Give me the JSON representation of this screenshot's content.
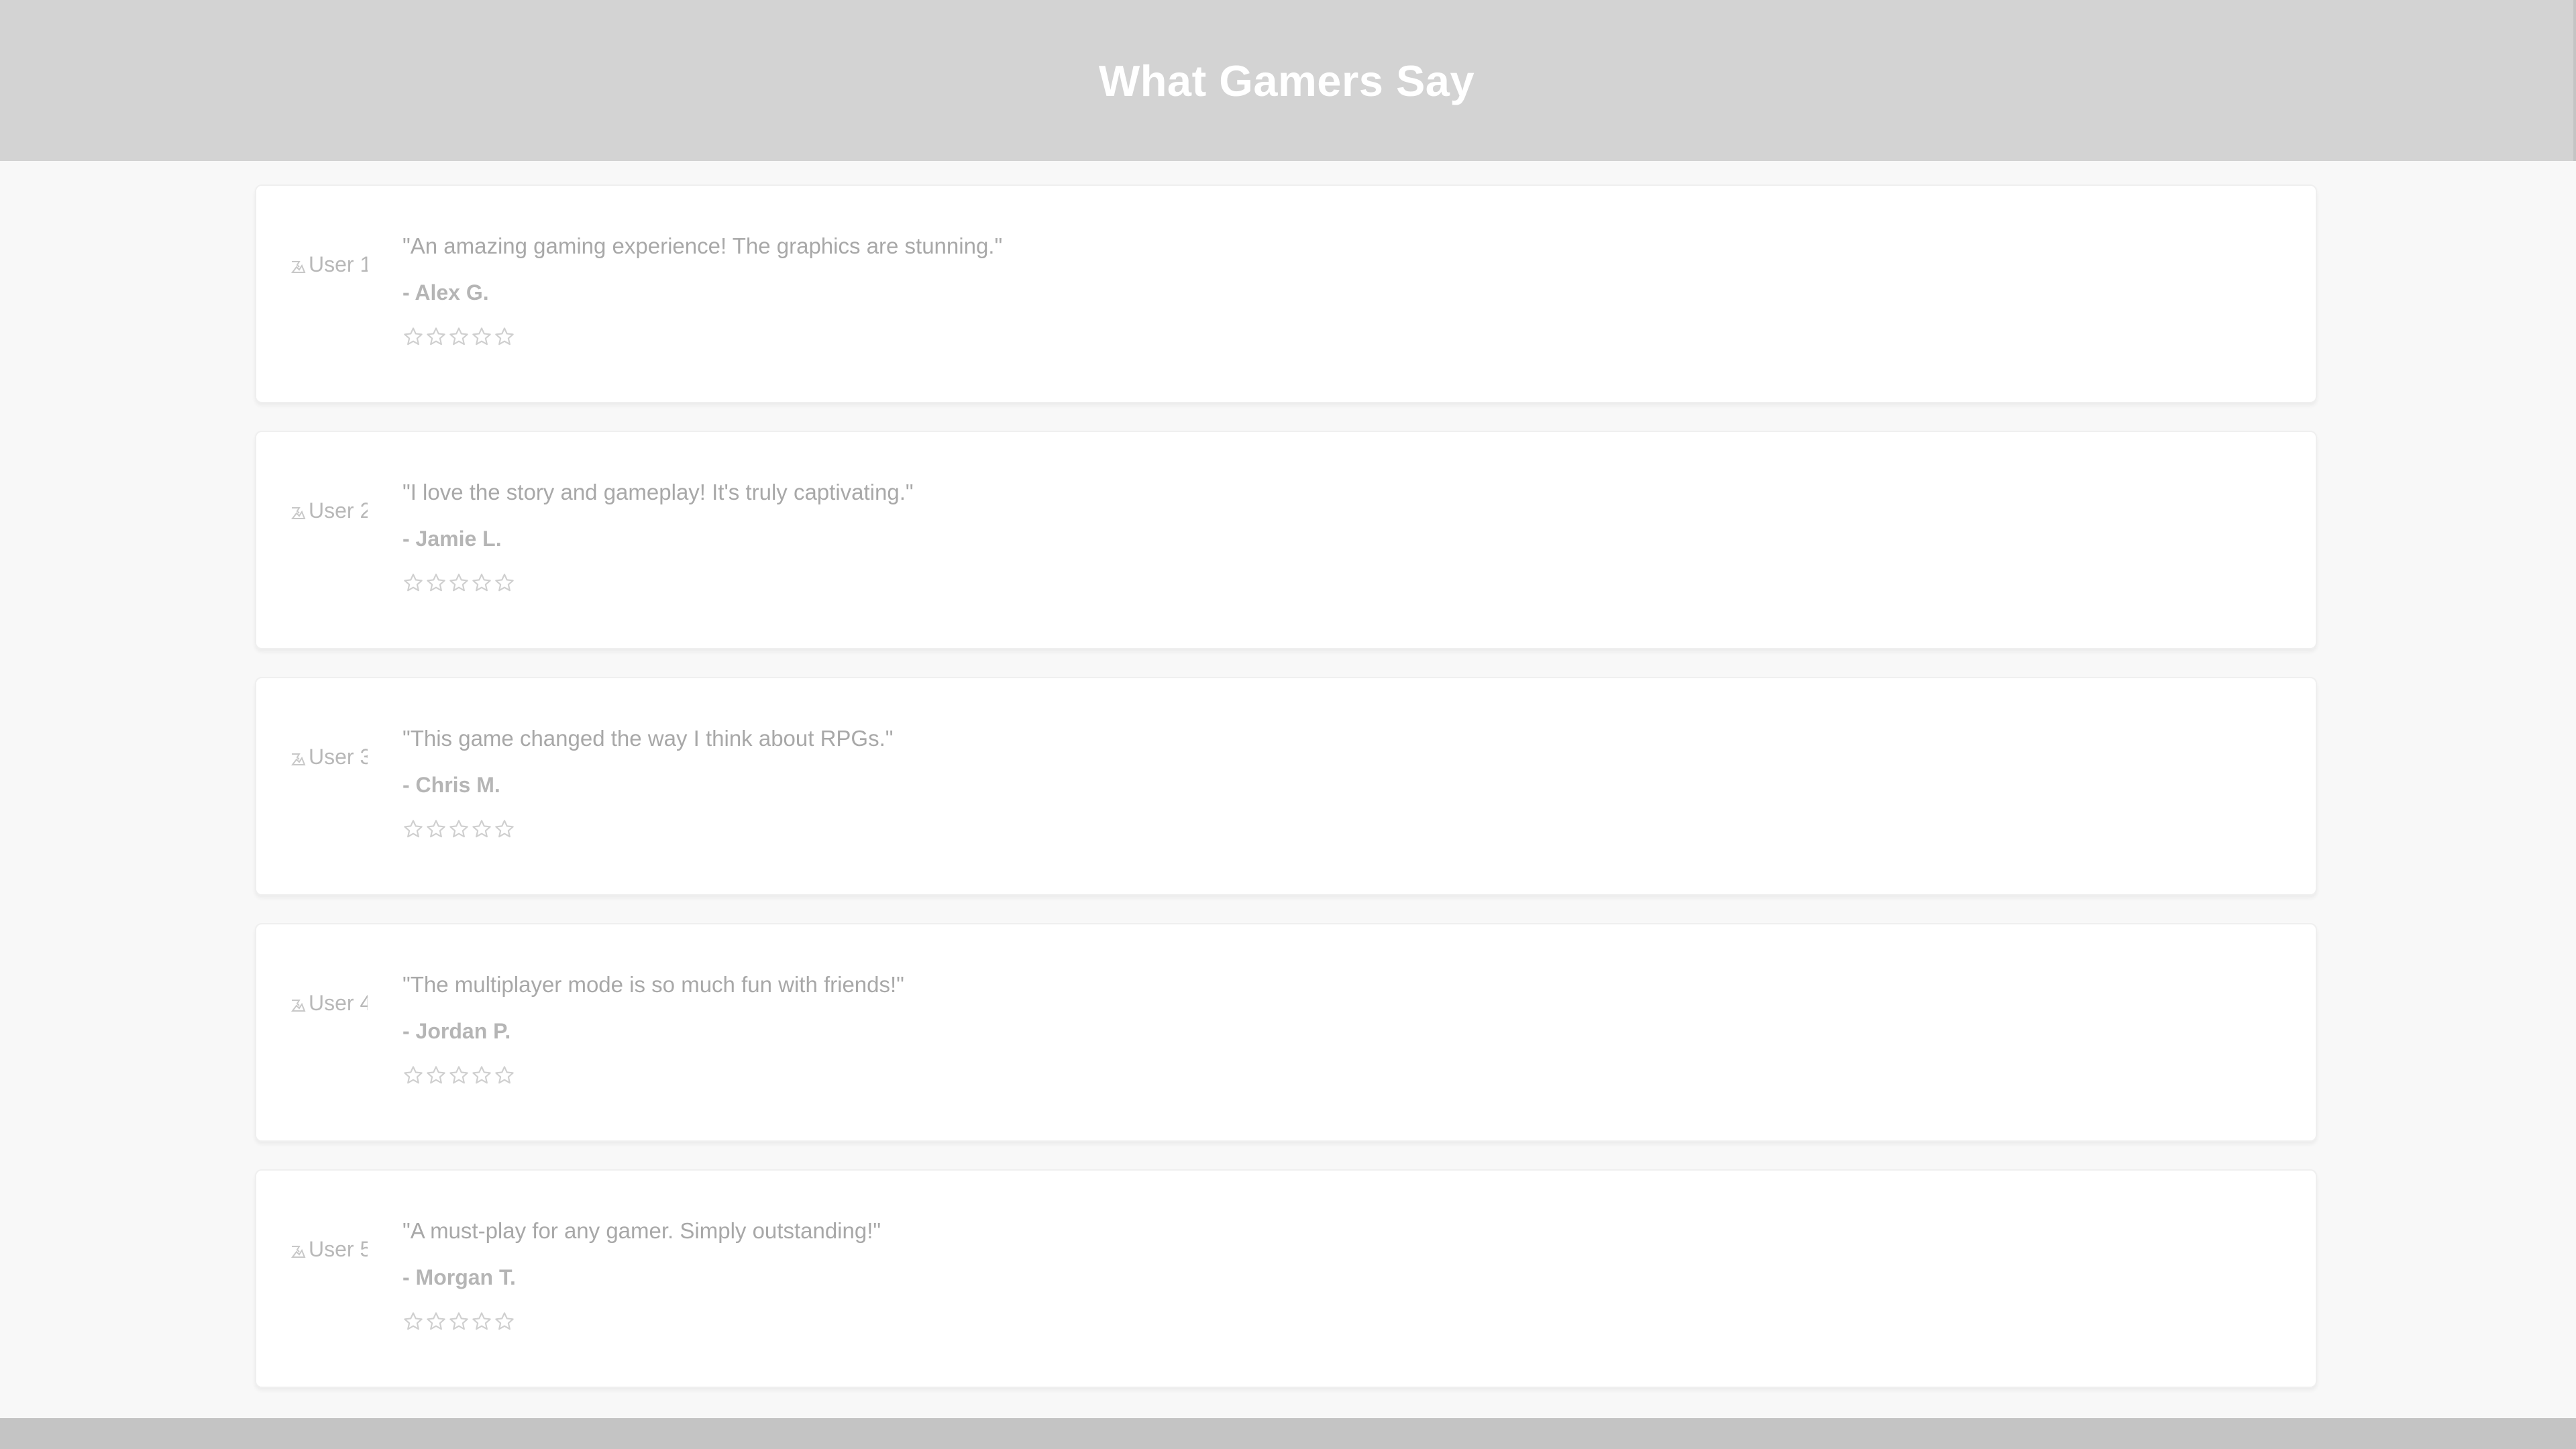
{
  "header": {
    "title": "What Gamers Say"
  },
  "testimonials": [
    {
      "avatar_alt": "User 1",
      "quote": "\"An amazing gaming experience! The graphics are stunning.\"",
      "author": "- Alex G.",
      "rating": 5
    },
    {
      "avatar_alt": "User 2",
      "quote": "\"I love the story and gameplay! It's truly captivating.\"",
      "author": "- Jamie L.",
      "rating": 5
    },
    {
      "avatar_alt": "User 3",
      "quote": "\"This game changed the way I think about RPGs.\"",
      "author": "- Chris M.",
      "rating": 5
    },
    {
      "avatar_alt": "User 4",
      "quote": "\"The multiplayer mode is so much fun with friends!\"",
      "author": "- Jordan P.",
      "rating": 5
    },
    {
      "avatar_alt": "User 5",
      "quote": "\"A must-play for any gamer. Simply outstanding!\"",
      "author": "- Morgan T.",
      "rating": 5
    }
  ],
  "colors": {
    "header_bg": "#d3d3d3",
    "page_bg": "#f8f8f8",
    "card_bg": "#ffffff",
    "footer_bg": "#c4c4c4",
    "star_outline": "#cfcfcf"
  },
  "icons": {
    "avatar": "broken-image-icon",
    "rating": "star-outline-icon"
  }
}
